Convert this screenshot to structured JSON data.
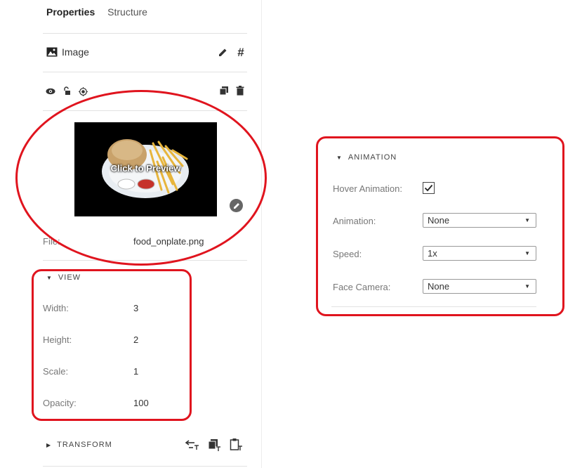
{
  "tabs": [
    {
      "label": "Properties"
    },
    {
      "label": "Structure"
    }
  ],
  "element": {
    "title": "Image",
    "icons": {
      "type": "image-icon",
      "edit": "pencil-icon",
      "id": "hash-icon",
      "visibility": "eye-icon",
      "lock": "lock-open-icon",
      "target": "target-icon",
      "duplicate": "duplicate-icon",
      "delete": "trash-icon"
    }
  },
  "preview": {
    "overlay_text": "Click to Preview",
    "edit_icon": "pencil-icon"
  },
  "file": {
    "label": "File:",
    "value": "food_onplate.png"
  },
  "view": {
    "header": "VIEW",
    "rows": [
      {
        "label": "Width:",
        "value": "3"
      },
      {
        "label": "Height:",
        "value": "2"
      },
      {
        "label": "Scale:",
        "value": "1"
      },
      {
        "label": "Opacity:",
        "value": "100"
      }
    ]
  },
  "transform": {
    "header": "TRANSFORM",
    "icons": [
      "reset-transform-icon",
      "copy-transform-icon",
      "paste-transform-icon"
    ]
  },
  "animation": {
    "header": "ANIMATION",
    "hover_label": "Hover Animation:",
    "hover_checked": true,
    "animation_label": "Animation:",
    "animation_value": "None",
    "speed_label": "Speed:",
    "speed_value": "1x",
    "face_camera_label": "Face Camera:",
    "face_camera_value": "None"
  },
  "colors": {
    "highlight": "#e0141e",
    "divider": "#e2e2e2"
  }
}
